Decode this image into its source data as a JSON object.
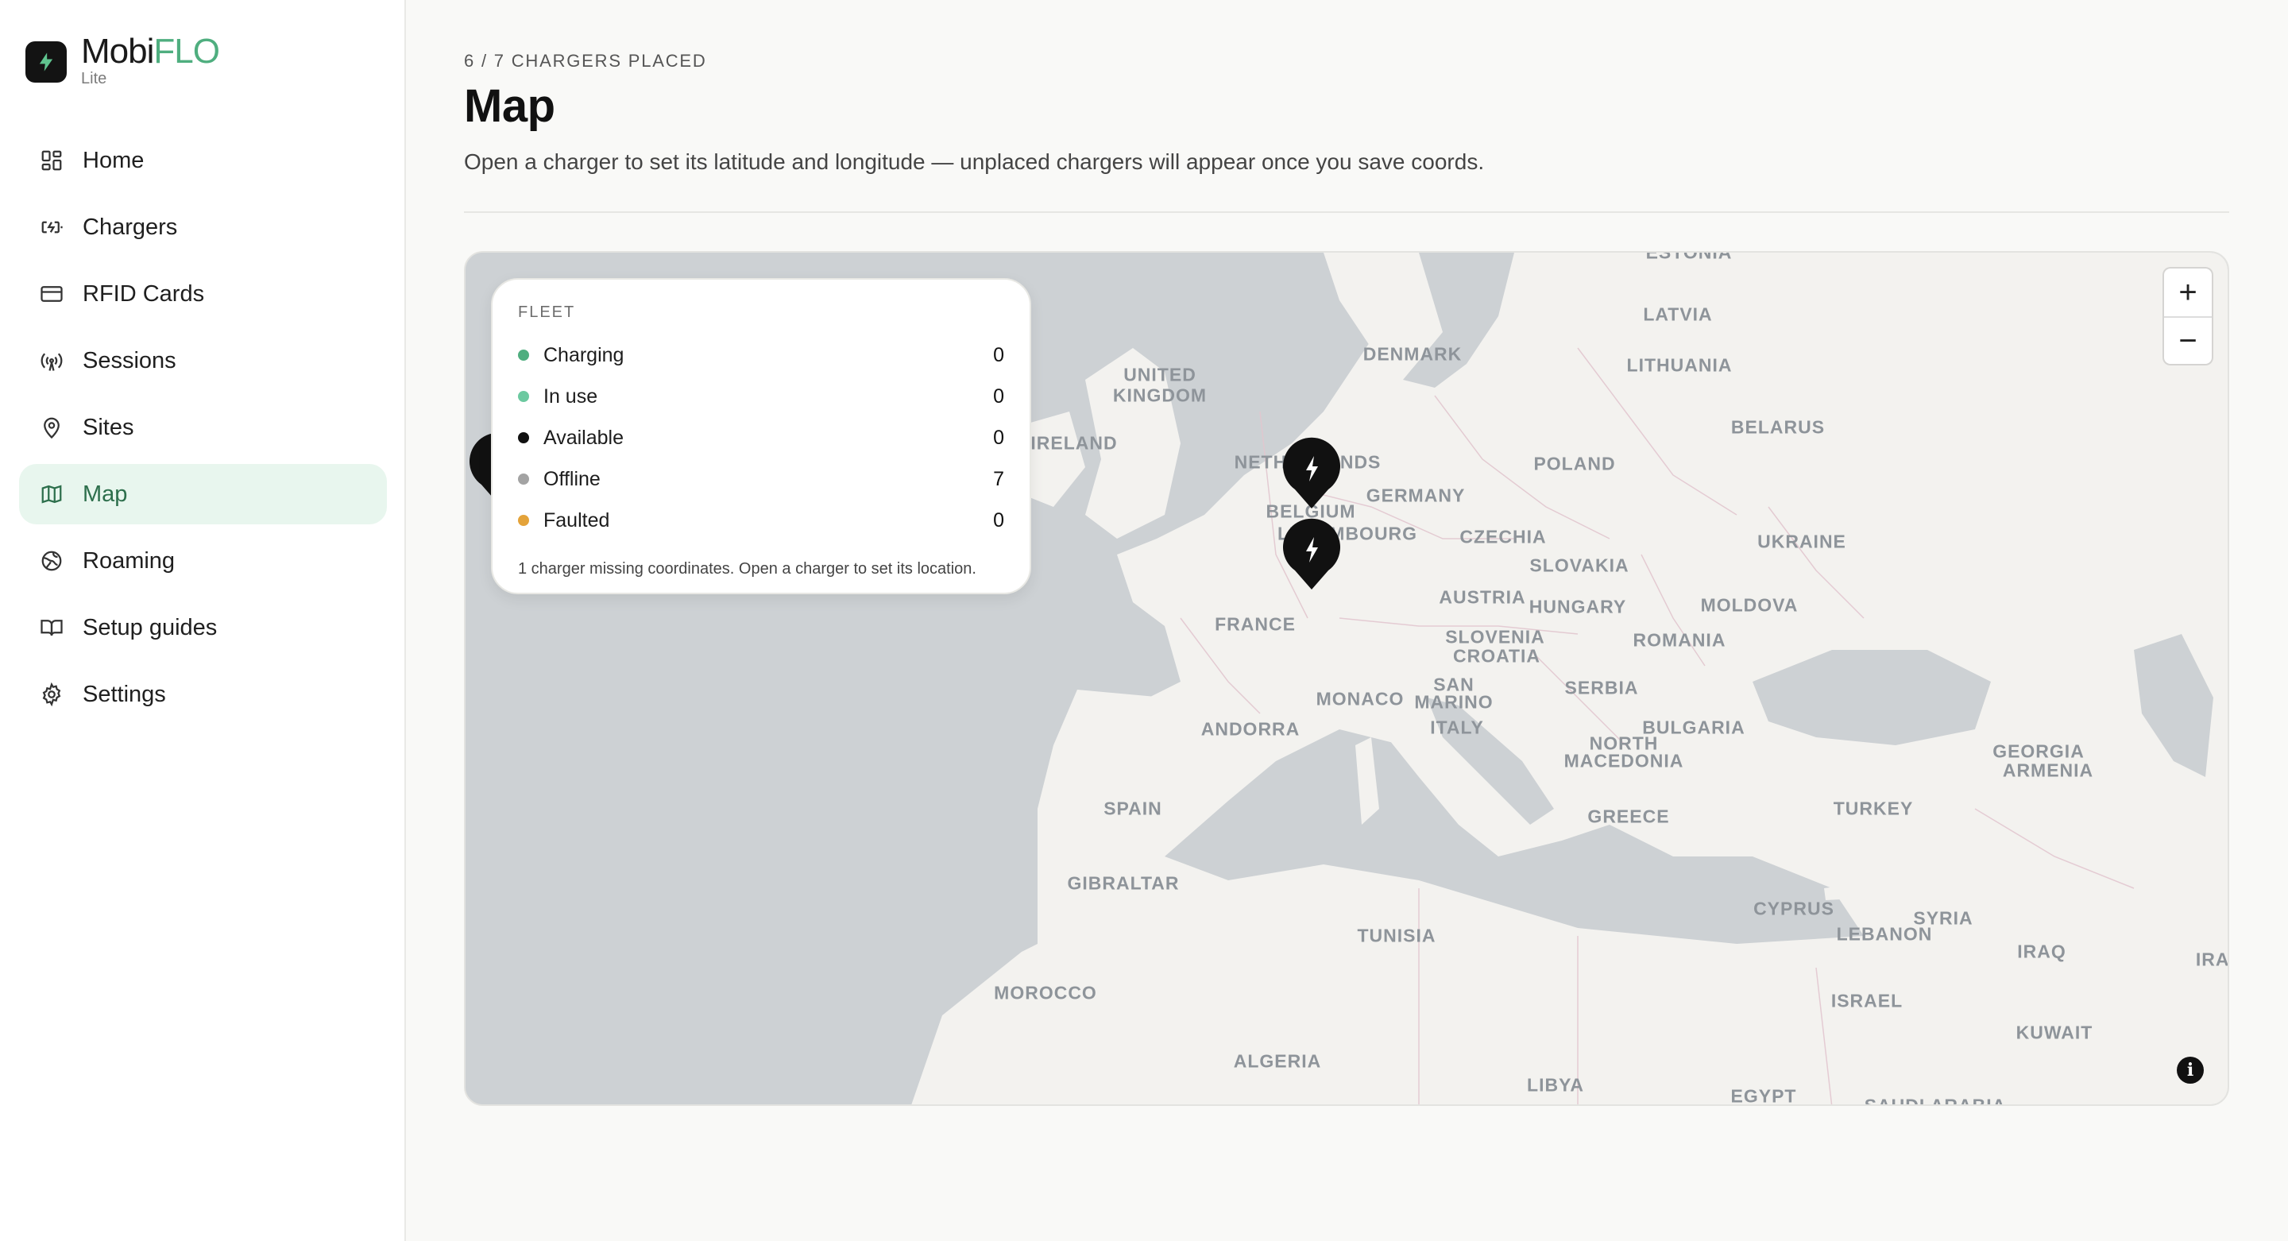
{
  "brand": {
    "name_main": "Mobi",
    "name_accent": "FLO",
    "subtitle": "Lite",
    "accent_color": "#4fae7f"
  },
  "nav": {
    "items": [
      {
        "label": "Home",
        "icon": "grid-icon"
      },
      {
        "label": "Chargers",
        "icon": "battery-charging-icon"
      },
      {
        "label": "RFID Cards",
        "icon": "card-icon"
      },
      {
        "label": "Sessions",
        "icon": "antenna-icon"
      },
      {
        "label": "Sites",
        "icon": "map-pin-icon"
      },
      {
        "label": "Map",
        "icon": "map-icon",
        "active": true
      },
      {
        "label": "Roaming",
        "icon": "globe-icon"
      },
      {
        "label": "Setup guides",
        "icon": "book-icon"
      },
      {
        "label": "Settings",
        "icon": "gear-icon"
      }
    ]
  },
  "header": {
    "eyebrow": "6 / 7 CHARGERS PLACED",
    "title": "Map",
    "description": "Open a charger to set its latitude and longitude — unplaced chargers will appear once you save coords."
  },
  "fleet": {
    "title": "FLEET",
    "rows": [
      {
        "name": "Charging",
        "count": "0",
        "color": "#4fae7f"
      },
      {
        "name": "In use",
        "count": "0",
        "color": "#6cc9a0"
      },
      {
        "name": "Available",
        "count": "0",
        "color": "#111111"
      },
      {
        "name": "Offline",
        "count": "7",
        "color": "#a3a3a3"
      },
      {
        "name": "Faulted",
        "count": "0",
        "color": "#e4a33a"
      }
    ],
    "note": "1 charger missing coordinates. Open a charger to set its location."
  },
  "map": {
    "zoom_in": "+",
    "zoom_out": "−",
    "info": "i",
    "labels": [
      {
        "name": "ESTONIA"
      },
      {
        "name": "LATVIA"
      },
      {
        "name": "LITHUANIA"
      },
      {
        "name": "DENMARK"
      },
      {
        "name": "UNITED"
      },
      {
        "name": "KINGDOM"
      },
      {
        "name": "IRELAND"
      },
      {
        "name": "NETHERLANDS"
      },
      {
        "name": "BELGIUM"
      },
      {
        "name": "LUXEMBOURG"
      },
      {
        "name": "GERMANY"
      },
      {
        "name": "POLAND"
      },
      {
        "name": "BELARUS"
      },
      {
        "name": "UKRAINE"
      },
      {
        "name": "CZECHIA"
      },
      {
        "name": "SLOVAKIA"
      },
      {
        "name": "AUSTRIA"
      },
      {
        "name": "HUNGARY"
      },
      {
        "name": "MOLDOVA"
      },
      {
        "name": "ROMANIA"
      },
      {
        "name": "FRANCE"
      },
      {
        "name": "SLOVENIA"
      },
      {
        "name": "CROATIA"
      },
      {
        "name": "SAN"
      },
      {
        "name": "MARINO"
      },
      {
        "name": "MONACO"
      },
      {
        "name": "ITALY"
      },
      {
        "name": "SERBIA"
      },
      {
        "name": "ANDORRA"
      },
      {
        "name": "BULGARIA"
      },
      {
        "name": "NORTH"
      },
      {
        "name": "MACEDONIA"
      },
      {
        "name": "GEORGIA"
      },
      {
        "name": "ARMENIA"
      },
      {
        "name": "SPAIN"
      },
      {
        "name": "GREECE"
      },
      {
        "name": "TURKEY"
      },
      {
        "name": "GIBRALTAR"
      },
      {
        "name": "TUNISIA"
      },
      {
        "name": "CYPRUS"
      },
      {
        "name": "SYRIA"
      },
      {
        "name": "LEBANON"
      },
      {
        "name": "IRAQ"
      },
      {
        "name": "IRAN"
      },
      {
        "name": "MOROCCO"
      },
      {
        "name": "ISRAEL"
      },
      {
        "name": "KUWAIT"
      },
      {
        "name": "ALGERIA"
      },
      {
        "name": "LIBYA"
      },
      {
        "name": "EGYPT"
      },
      {
        "name": "SAUDI ARABIA"
      }
    ]
  }
}
